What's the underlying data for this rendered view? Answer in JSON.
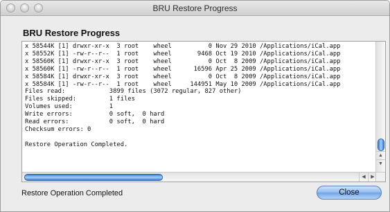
{
  "window": {
    "title": "BRU Restore Progress"
  },
  "heading": "BRU Restore Progress",
  "log": {
    "lines": [
      "x 58544K [1] drwxr-xr-x  3 root    wheel          0 Nov 29 2010 /Applications/iCal.app",
      "x 58552K [1] -rw-r--r--  1 root    wheel       9468 Oct 19 2010 /Applications/iCal.app",
      "x 58560K [1] drwxr-xr-x  3 root    wheel          0 Oct  8 2009 /Applications/iCal.app",
      "x 58560K [1] -rw-r--r--  1 root    wheel      16596 Apr 25 2009 /Applications/iCal.app",
      "x 58584K [1] drwxr-xr-x  3 root    wheel          0 Oct  8 2009 /Applications/iCal.app",
      "x 58584K [1] -rw-r--r--  1 root    wheel     144951 May 10 2009 /Applications/iCal.app",
      "Files read:            3899 files (3072 regular, 827 other)",
      "Files skipped:         1 files",
      "Volumes used:          1",
      "Write errors:          0 soft,  0 hard",
      "Read errors:           0 soft,  0 hard",
      "Checksum errors: 0",
      "",
      "Restore Operation Completed."
    ]
  },
  "scrollbars": {
    "up_arrow": "▲",
    "down_arrow": "▼",
    "left_arrow": "◀",
    "right_arrow": "▶"
  },
  "status_text": "Restore Operation Completed",
  "close_button_label": "Close",
  "colors": {
    "accent": "#3b7fd4",
    "window_bg": "#ececec"
  }
}
